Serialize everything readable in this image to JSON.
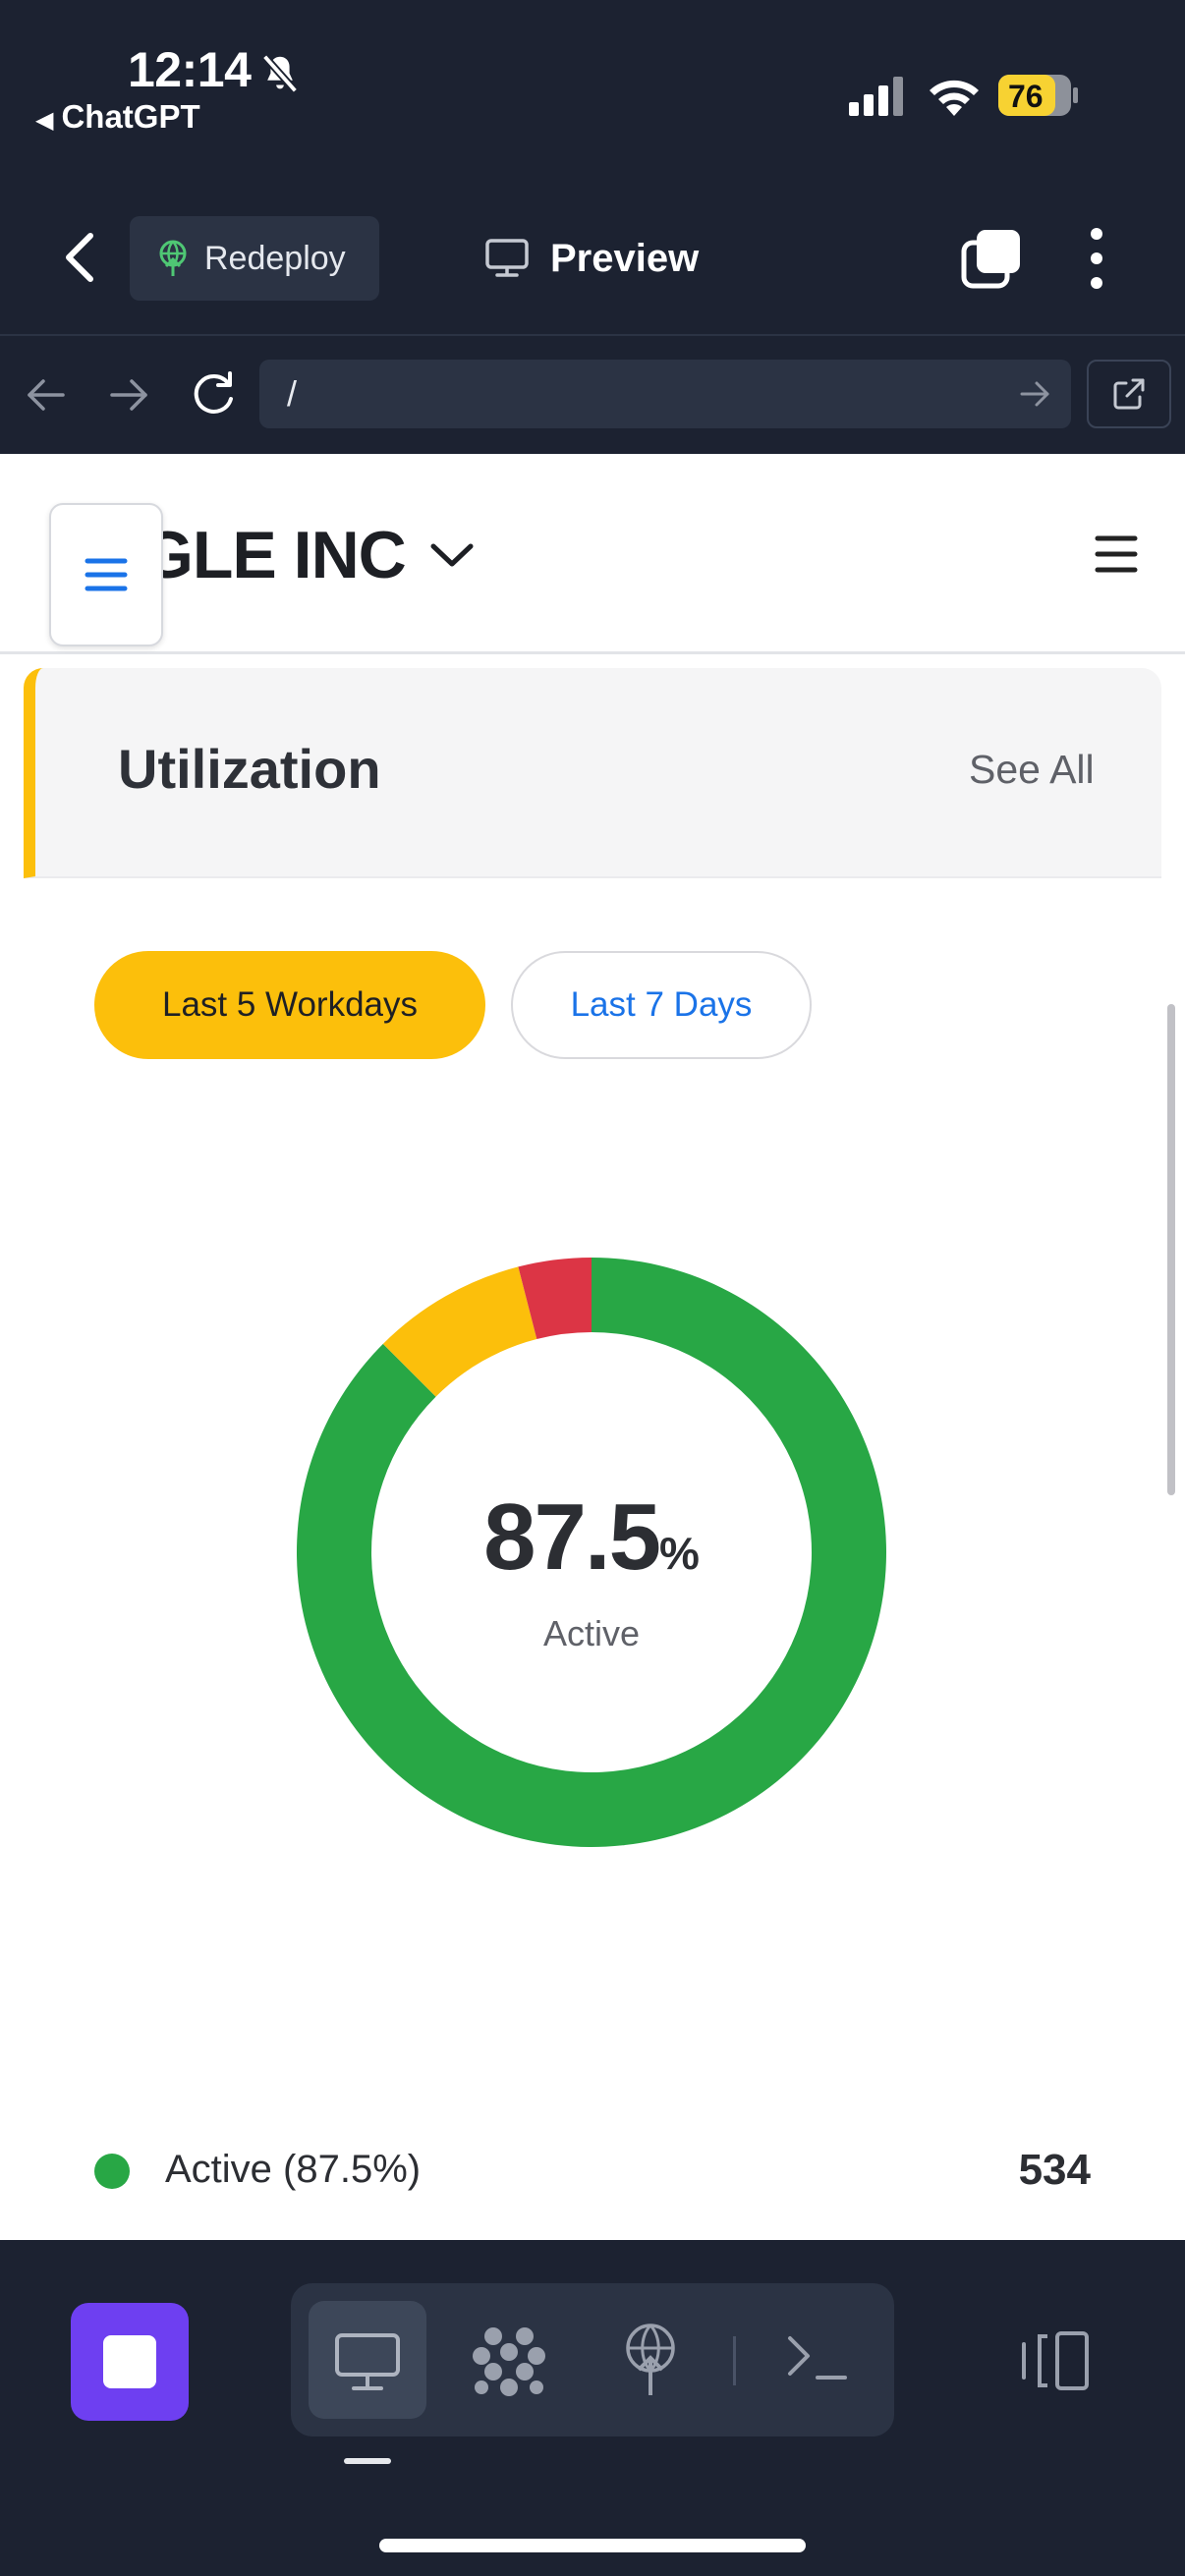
{
  "status_bar": {
    "time": "12:14",
    "back_app": "ChatGPT",
    "battery": "76",
    "icons": [
      "bell-slash-icon",
      "signal-icon",
      "wifi-icon",
      "battery-icon"
    ]
  },
  "header": {
    "redeploy_label": "Redeploy",
    "preview_label": "Preview"
  },
  "url_bar": {
    "value": "/"
  },
  "site": {
    "company": "GLE INC"
  },
  "card": {
    "title": "Utilization",
    "see_all": "See All",
    "filters": [
      {
        "label": "Last 5 Workdays",
        "selected": true
      },
      {
        "label": "Last 7 Days",
        "selected": false
      }
    ],
    "center_value": "87.5",
    "center_unit": "%",
    "center_label": "Active",
    "legend": [
      {
        "label": "Active (87.5%)",
        "count": "534",
        "color": "#28a745"
      }
    ]
  },
  "chart_data": {
    "type": "pie",
    "title": "",
    "segments": [
      {
        "name": "Active",
        "value": 87.5,
        "color": "#28a745"
      },
      {
        "name": "",
        "value": 8.5,
        "color": "#fcbf0b"
      },
      {
        "name": "",
        "value": 4.0,
        "color": "#dc3545"
      }
    ]
  },
  "colors": {
    "accent_yellow": "#fcbf0b",
    "link_blue": "#1a73e8",
    "stop_purple": "#6e3ff1",
    "dark_bg": "#1c2231"
  }
}
